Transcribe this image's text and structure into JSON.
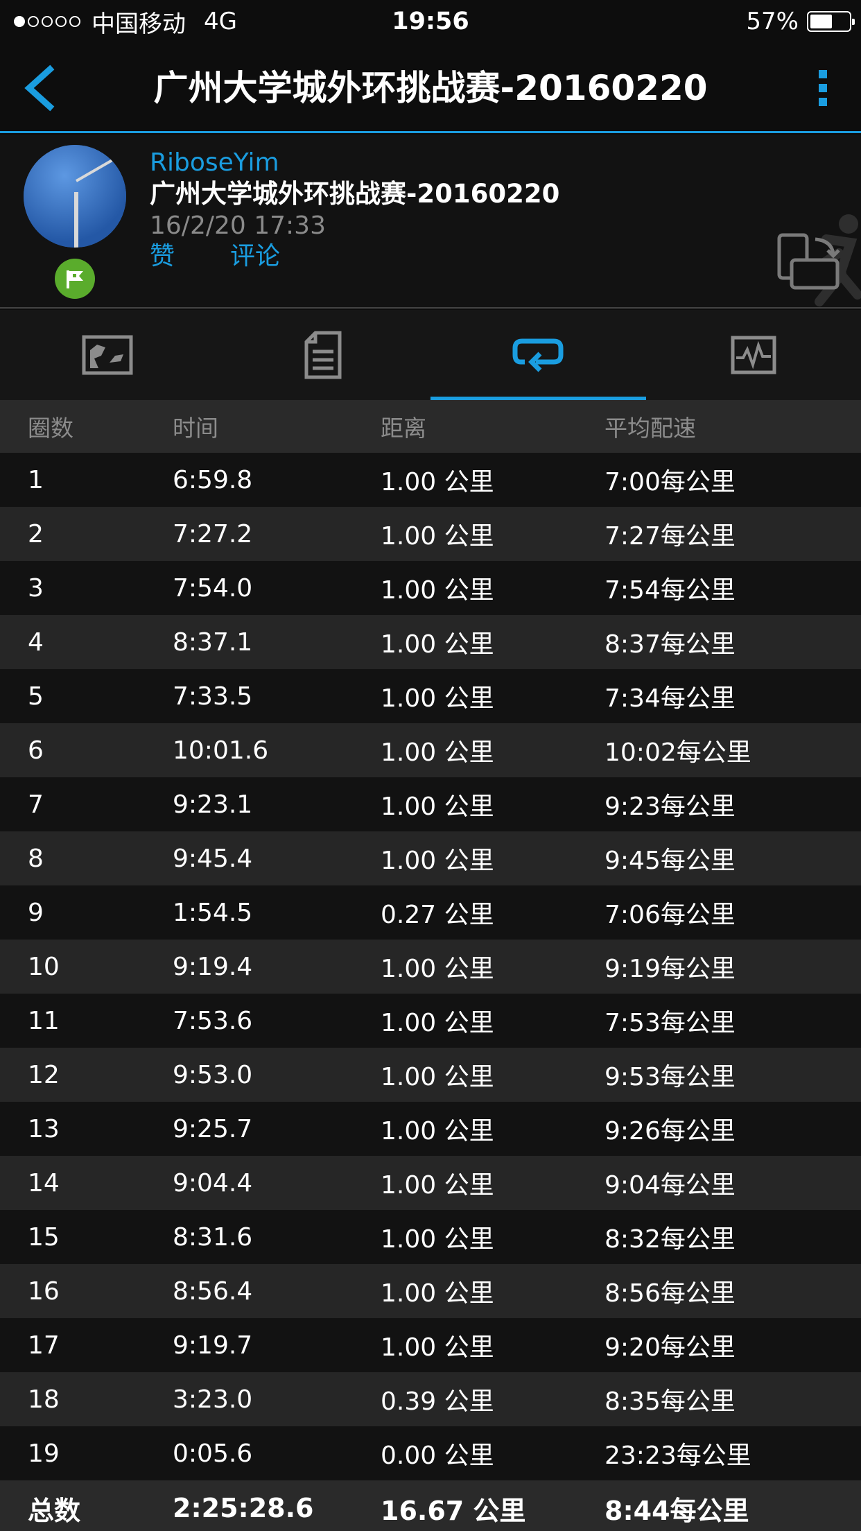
{
  "status_bar": {
    "carrier": "中国移动",
    "network": "4G",
    "time": "19:56",
    "battery_percent": "57%",
    "battery_level": 0.57,
    "signal_bars_filled": 1,
    "signal_bars_total": 5
  },
  "nav": {
    "title": "广州大学城外环挑战赛-20160220",
    "back_icon": "chevron-left-icon",
    "more_icon": "vertical-dots-icon",
    "accent_color": "#1a9de0"
  },
  "activity": {
    "user_name": "RiboseYim",
    "title": "广州大学城外环挑战赛-20160220",
    "date": "16/2/20 17:33",
    "like_label": "赞",
    "comment_label": "评论",
    "badge_icon": "flag-icon",
    "badge_color": "#5aac2c"
  },
  "tabs": [
    {
      "icon": "map-icon",
      "active": false
    },
    {
      "icon": "details-icon",
      "active": false
    },
    {
      "icon": "laps-icon",
      "active": true
    },
    {
      "icon": "chart-icon",
      "active": false
    }
  ],
  "table": {
    "headers": [
      "圈数",
      "时间",
      "距离",
      "平均配速"
    ],
    "rows": [
      [
        "1",
        "6:59.8",
        "1.00 公里",
        "7:00每公里"
      ],
      [
        "2",
        "7:27.2",
        "1.00 公里",
        "7:27每公里"
      ],
      [
        "3",
        "7:54.0",
        "1.00 公里",
        "7:54每公里"
      ],
      [
        "4",
        "8:37.1",
        "1.00 公里",
        "8:37每公里"
      ],
      [
        "5",
        "7:33.5",
        "1.00 公里",
        "7:34每公里"
      ],
      [
        "6",
        "10:01.6",
        "1.00 公里",
        "10:02每公里"
      ],
      [
        "7",
        "9:23.1",
        "1.00 公里",
        "9:23每公里"
      ],
      [
        "8",
        "9:45.4",
        "1.00 公里",
        "9:45每公里"
      ],
      [
        "9",
        "1:54.5",
        "0.27 公里",
        "7:06每公里"
      ],
      [
        "10",
        "9:19.4",
        "1.00 公里",
        "9:19每公里"
      ],
      [
        "11",
        "7:53.6",
        "1.00 公里",
        "7:53每公里"
      ],
      [
        "12",
        "9:53.0",
        "1.00 公里",
        "9:53每公里"
      ],
      [
        "13",
        "9:25.7",
        "1.00 公里",
        "9:26每公里"
      ],
      [
        "14",
        "9:04.4",
        "1.00 公里",
        "9:04每公里"
      ],
      [
        "15",
        "8:31.6",
        "1.00 公里",
        "8:32每公里"
      ],
      [
        "16",
        "8:56.4",
        "1.00 公里",
        "8:56每公里"
      ],
      [
        "17",
        "9:19.7",
        "1.00 公里",
        "9:20每公里"
      ],
      [
        "18",
        "3:23.0",
        "0.39 公里",
        "8:35每公里"
      ],
      [
        "19",
        "0:05.6",
        "0.00 公里",
        "23:23每公里"
      ]
    ],
    "total": [
      "总数",
      "2:25:28.6",
      "16.67 公里",
      "8:44每公里"
    ]
  }
}
